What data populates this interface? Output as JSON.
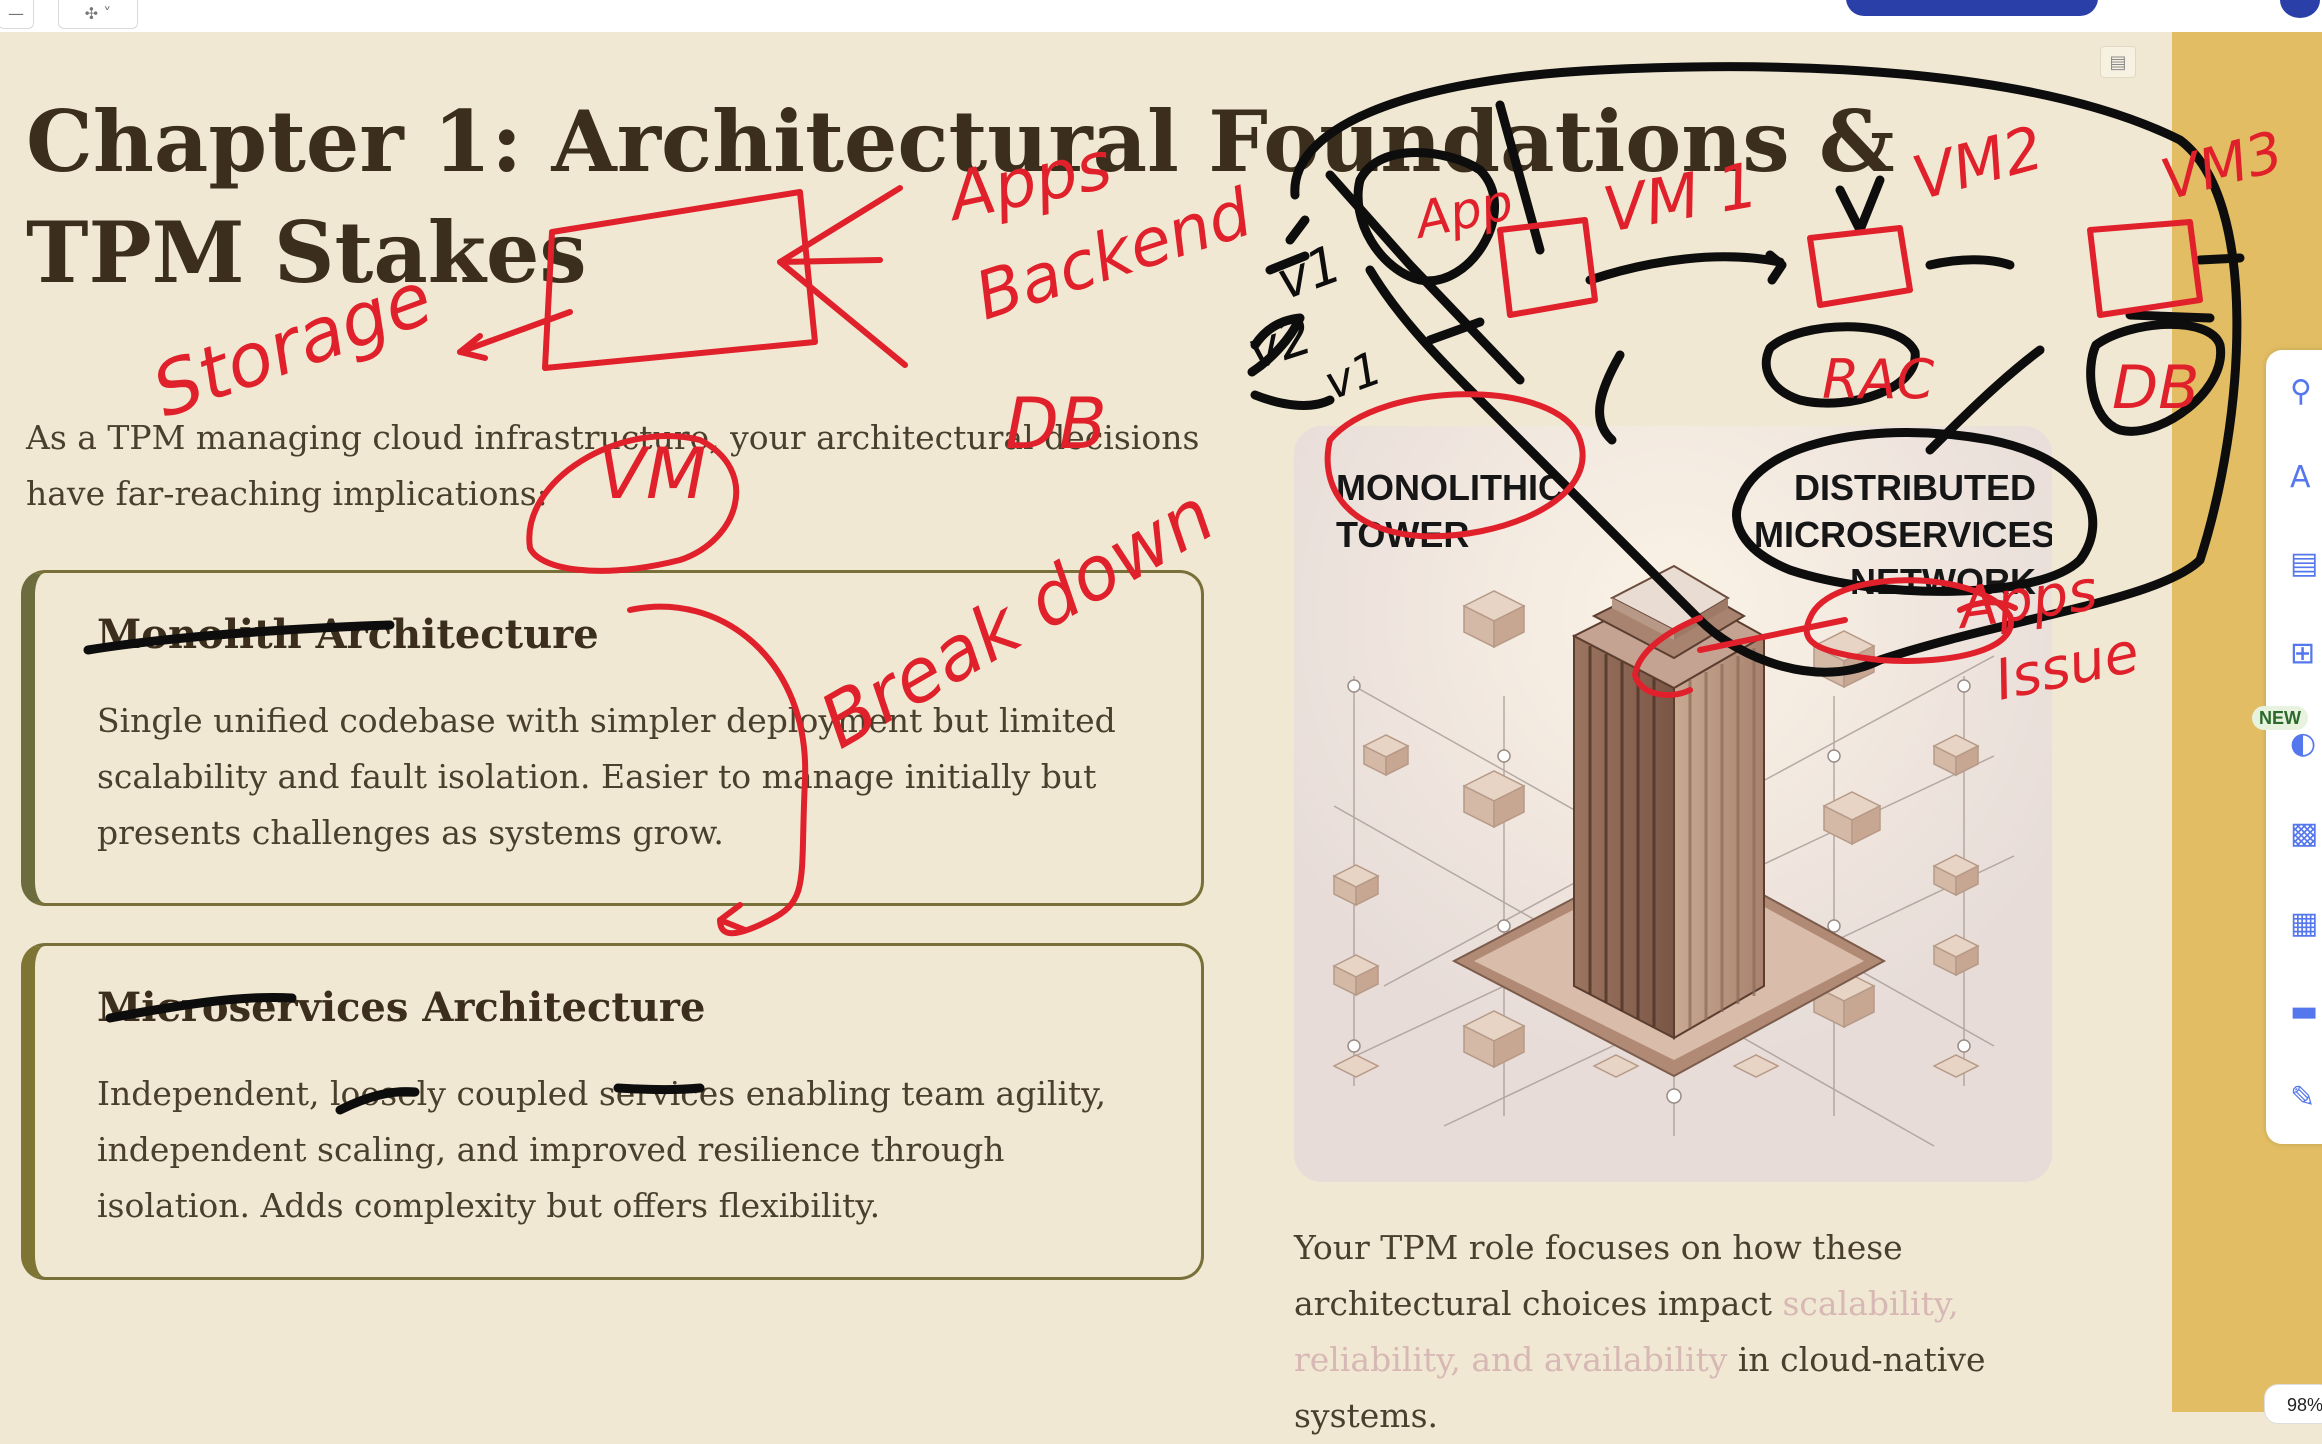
{
  "topbar": {
    "left_buttons": [
      "—",
      "✣ ˅"
    ],
    "page_icon": "page-icon"
  },
  "slide": {
    "title": "Chapter 1: Architectural Foundations & TPM Stakes",
    "intro": "As a TPM managing cloud infrastructure, your architectural decisions have far-reaching implications:",
    "cards": [
      {
        "heading": "Monolith Architecture",
        "body": "Single unified codebase with simpler deployment but limited scalability and fault isolation. Easier to manage initially but presents challenges as systems grow."
      },
      {
        "heading": "Microservices Architecture",
        "body": "Independent, loosely coupled services enabling team agility, independent scaling, and improved resilience through isolation. Adds complexity but offers flexibility."
      }
    ],
    "image": {
      "label_left": "MONOLITHIC TOWER",
      "label_right": "DISTRIBUTED MICROSERVICES NETWORK"
    },
    "tpm_text": {
      "before": "Your TPM role focuses on how these architectural choices impact ",
      "highlight": "scalability, reliability, and availability",
      "after": " in cloud-native systems."
    }
  },
  "sidepanel": {
    "new_badge": "NEW",
    "icons": [
      "search-icon",
      "text-icon",
      "image-icon",
      "apps-icon",
      "ai-icon",
      "chart-icon",
      "table-icon",
      "layout-icon",
      "edit-icon"
    ],
    "text_glyph": "A"
  },
  "zoom": "98%",
  "annotations": {
    "red_words": [
      "Storage",
      "Apps",
      "Backend",
      "DB",
      "VM",
      "Break down",
      "App",
      "VM 1",
      "VM2",
      "VM3",
      "RAC",
      "DB",
      "Apps",
      "Issue"
    ],
    "black_words": [
      "v1",
      "v2",
      "v1"
    ],
    "red_color": "#e0202a",
    "black_color": "#0d0d0d"
  },
  "colors": {
    "background": "#f1e8d3",
    "accent_band": "#e2bd63",
    "title_text": "#3b2e1c",
    "card_border": "#787038",
    "highlight_text": "#d7b8b5",
    "primary_button": "#2b3fa8"
  }
}
